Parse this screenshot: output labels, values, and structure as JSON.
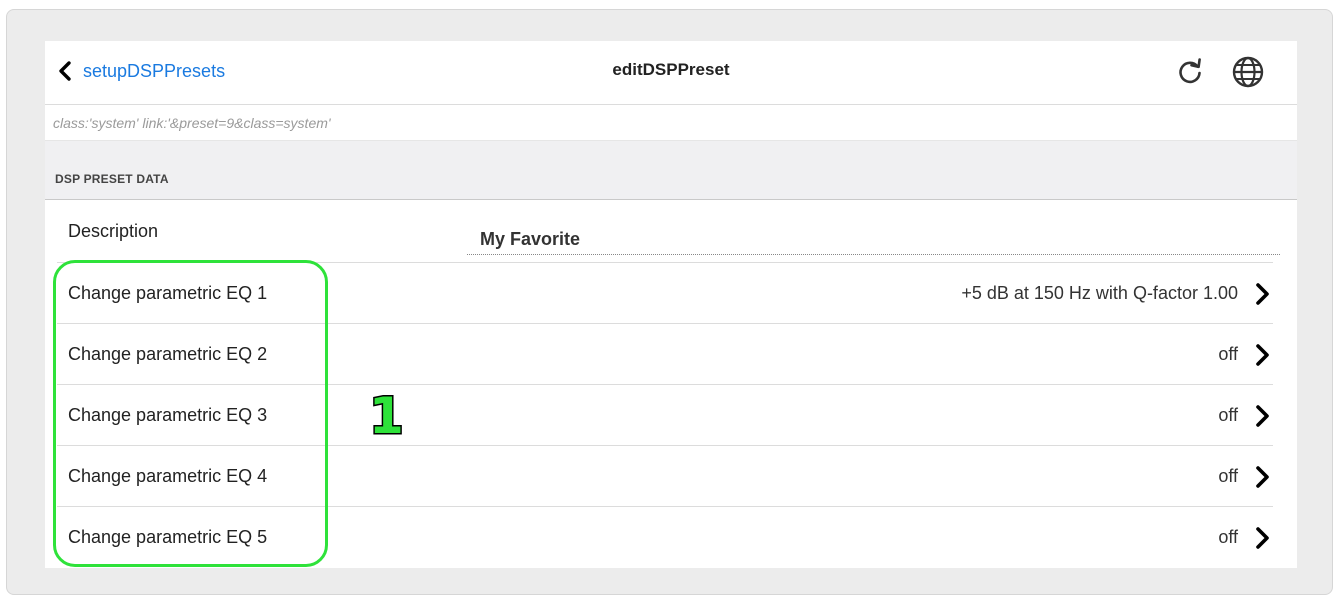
{
  "nav": {
    "back_label": "setupDSPPresets",
    "title": "editDSPPreset",
    "back_icon": "chevron-left-icon",
    "reload_icon": "reload-icon",
    "globe_icon": "globe-icon",
    "link_color": "#1a7ae0"
  },
  "info": {
    "text": "class:'system' link:'&preset=9&class=system'"
  },
  "section": {
    "title": "DSP PRESET DATA"
  },
  "description": {
    "label": "Description",
    "value": "My Favorite"
  },
  "rows": [
    {
      "label": "Change parametric EQ 1",
      "value": "+5 dB at 150 Hz with Q-factor 1.00",
      "icon": "chevron-right-icon"
    },
    {
      "label": "Change parametric EQ 2",
      "value": "off",
      "icon": "chevron-right-icon"
    },
    {
      "label": "Change parametric EQ 3",
      "value": "off",
      "icon": "chevron-right-icon"
    },
    {
      "label": "Change parametric EQ 4",
      "value": "off",
      "icon": "chevron-right-icon"
    },
    {
      "label": "Change parametric EQ 5",
      "value": "off",
      "icon": "chevron-right-icon"
    }
  ],
  "annotation": {
    "number": "1",
    "color": "#2ee23a"
  }
}
